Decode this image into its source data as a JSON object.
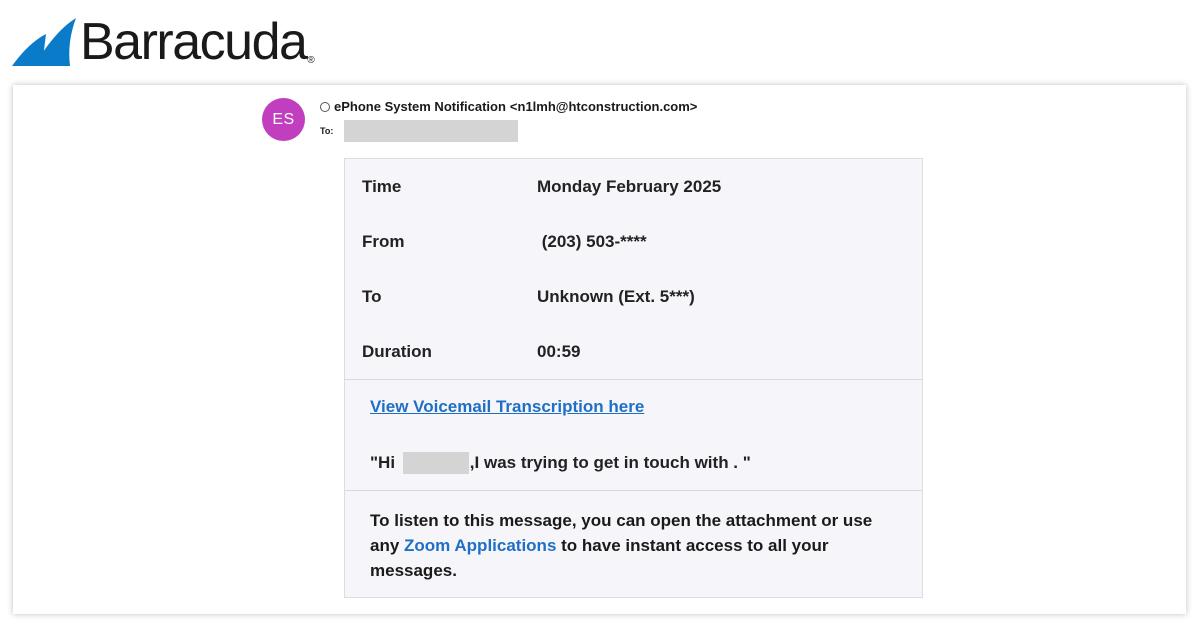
{
  "logo": {
    "text": "Barracuda",
    "reg": "®",
    "icon": "barracuda-fin-icon",
    "color": "#0a7bc8"
  },
  "email": {
    "avatar_initials": "ES",
    "avatar_color": "#c13fbf",
    "sender_name": "ePhone System Notification",
    "sender_email": "<n1lmh@htconstruction.com>",
    "to_label": "To:"
  },
  "voicemail": {
    "fields": [
      {
        "label": "Time",
        "value": "Monday February 2025"
      },
      {
        "label": "From",
        "value": " (203) 503-****"
      },
      {
        "label": "To",
        "value": "Unknown (Ext. 5***)"
      },
      {
        "label": "Duration",
        "value": "00:59"
      }
    ],
    "transcription_link": "View Voicemail Transcription here",
    "quote_start": "\"Hi ",
    "quote_end": ",I was trying to get in touch with . \"",
    "footer_pre": "To listen to this message, you can open the attachment or use any ",
    "footer_link": "Zoom Applications",
    "footer_post": " to have instant access to all your messages.",
    "link_color": "#1f6fc5"
  }
}
